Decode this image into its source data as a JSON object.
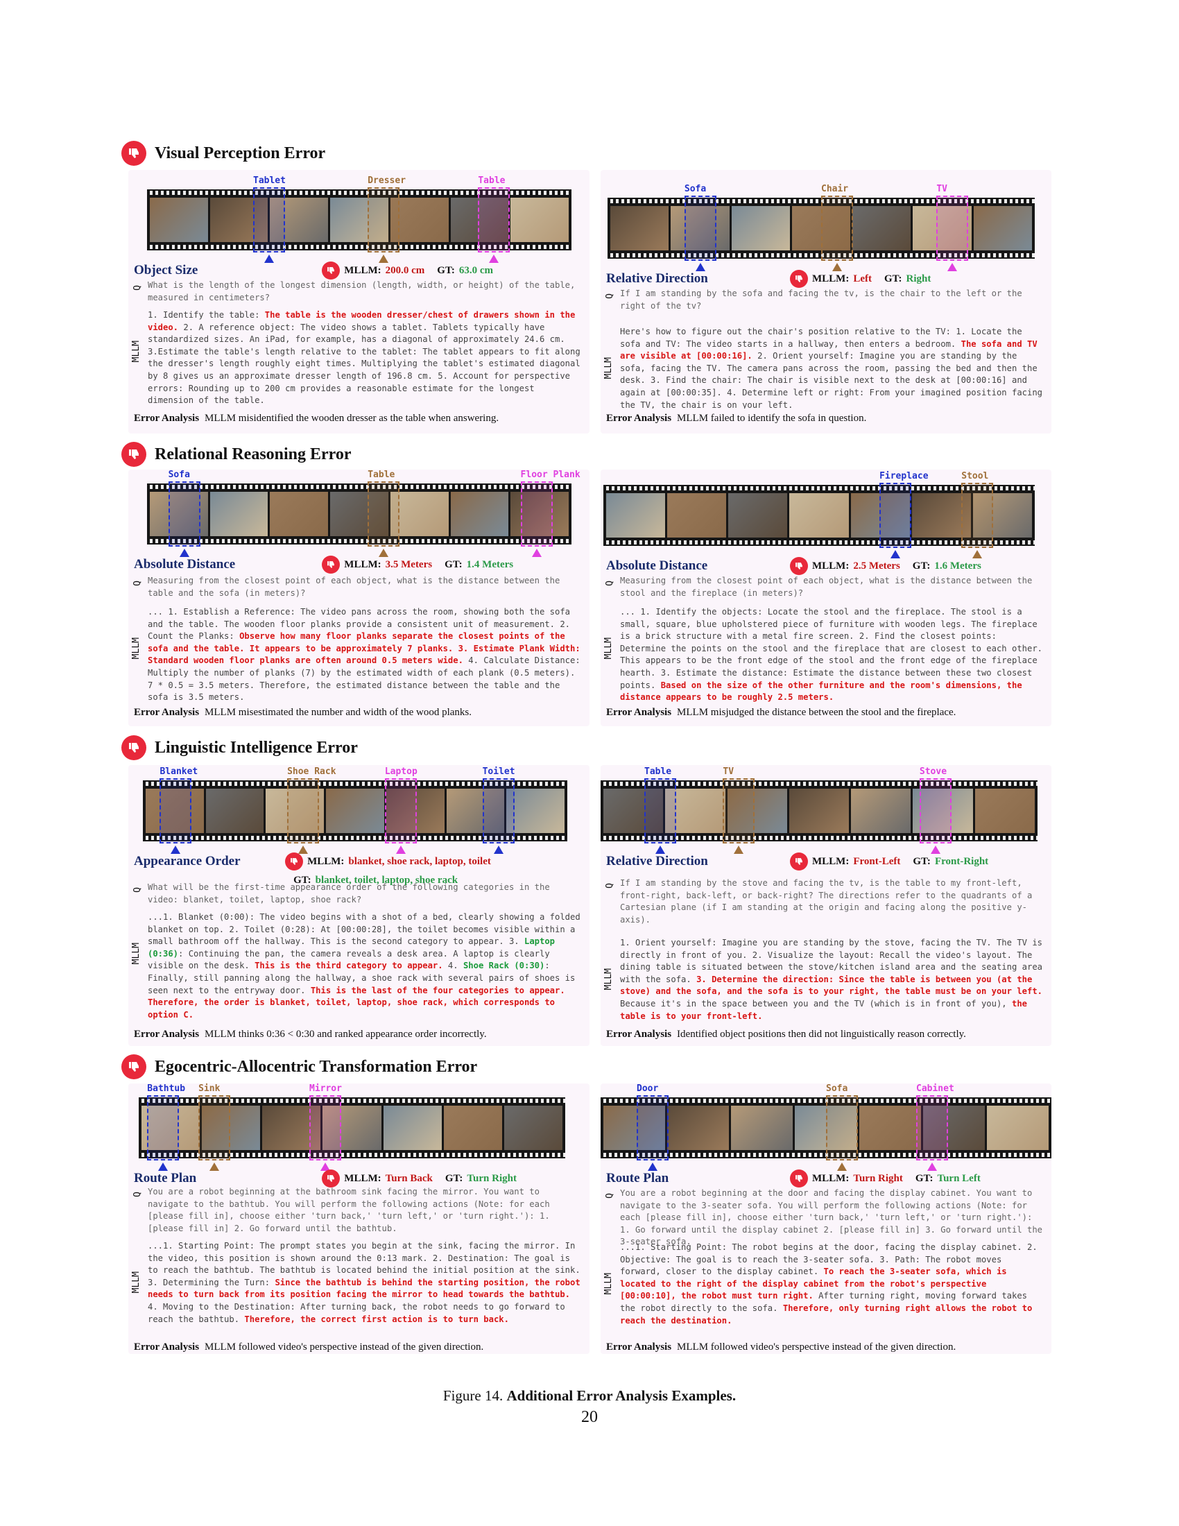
{
  "sections": [
    {
      "title": "Visual Perception Error"
    },
    {
      "title": "Relational Reasoning Error"
    },
    {
      "title": "Linguistic Intelligence Error"
    },
    {
      "title": "Egocentric-Allocentric Transformation Error"
    }
  ],
  "cards": [
    {
      "subtitle": "Object Size",
      "tags": [
        "Tablet",
        "Dresser",
        "Table"
      ],
      "mllm_label": "MLLM:",
      "mllm_value": "200.0 cm",
      "gt_label": "GT:",
      "gt_value": "63.0 cm",
      "q_label": "Q",
      "m_label": "MLLM",
      "question": "What is the length of the longest dimension (length, width, or height) of the table, measured in centimeters?",
      "answer": [
        {
          "t": "1. Identify the table: "
        },
        {
          "t": "The table is the wooden dresser/chest of drawers shown in the video.",
          "c": "red"
        },
        {
          "t": " 2. A reference object: The video shows a tablet. Tablets typically have standardized sizes. An iPad, for example, has a diagonal of approximately 24.6 cm. 3.Estimate the table's length relative to the tablet: The tablet appears to fit along the dresser's length roughly eight times. Multiplying the tablet's estimated diagonal by 8 gives us an approximate dresser length of 196.8 cm. 5. Account for perspective errors: Rounding up to 200 cm provides a reasonable estimate for the longest dimension of the table."
        }
      ],
      "ea_label": "Error Analysis",
      "ea_text": "MLLM misidentified the wooden dresser as the table when answering."
    },
    {
      "subtitle": "Relative Direction",
      "tags": [
        "Sofa",
        "Chair",
        "TV"
      ],
      "mllm_label": "MLLM:",
      "mllm_value": "Left",
      "gt_label": "GT:",
      "gt_value": "Right",
      "q_label": "Q",
      "m_label": "MLLM",
      "question": "If I am standing by the sofa and facing the tv, is the chair to the left or the right of the tv?",
      "answer": [
        {
          "t": "Here's how to figure out the chair's position relative to the TV: 1. Locate the sofa and TV: The video starts in a hallway, then enters a bedroom. "
        },
        {
          "t": "The sofa and TV are visible at [00:00:16].",
          "c": "red"
        },
        {
          "t": " 2. Orient yourself: Imagine you are standing by the sofa, facing the TV.  The camera pans across the room, passing the bed and then the desk. 3. Find the chair: The chair is visible next to the desk at [00:00:16] and again at [00:00:35]. 4. Determine left or right: From your imagined position facing the TV, the chair is on your left."
        }
      ],
      "ea_label": "Error Analysis",
      "ea_text": "MLLM failed to identify the sofa in question."
    },
    {
      "subtitle": "Absolute Distance",
      "tags": [
        "Sofa",
        "Table",
        "Floor Plank"
      ],
      "mllm_label": "MLLM:",
      "mllm_value": "3.5 Meters",
      "gt_label": "GT:",
      "gt_value": "1.4 Meters",
      "q_label": "Q",
      "m_label": "MLLM",
      "question": "Measuring from the closest point of each object, what is the distance between the table and the sofa (in meters)?",
      "answer": [
        {
          "t": "... 1. Establish a Reference: The video pans across the room, showing both the sofa and the table. The wooden floor planks provide a consistent unit of measurement. 2. Count the Planks: "
        },
        {
          "t": "Observe how many floor planks separate the closest points of the sofa and the table. It appears to be approximately 7 planks. 3. Estimate Plank Width: Standard wooden floor planks are often around 0.5 meters wide.",
          "c": "red"
        },
        {
          "t": " 4. Calculate Distance: Multiply the number of planks (7) by the estimated width of each plank (0.5 meters). 7 * 0.5 = 3.5 meters. Therefore, the estimated distance between the table and the sofa is 3.5 meters."
        }
      ],
      "ea_label": "Error Analysis",
      "ea_text": "MLLM misestimated the number and width of the wood planks."
    },
    {
      "subtitle": "Absolute Distance",
      "tags": [
        "Fireplace",
        "Stool"
      ],
      "mllm_label": "MLLM:",
      "mllm_value": "2.5 Meters",
      "gt_label": "GT:",
      "gt_value": "1.6 Meters",
      "q_label": "Q",
      "m_label": "MLLM",
      "question": "Measuring from the closest point of each object, what is the distance between the stool and the fireplace (in meters)?",
      "answer": [
        {
          "t": "... 1. Identify the objects: Locate the stool and the fireplace. The stool is a small, square, blue upholstered piece of furniture with wooden legs. The fireplace is a brick structure with a metal fire screen. 2. Find the closest points: Determine the points on the stool and the fireplace that are closest to each other. This appears to be the front edge of the stool and the front edge of the fireplace hearth. 3. Estimate the distance: Estimate the distance between these two closest points. "
        },
        {
          "t": "Based on the size of the other furniture and the room's dimensions, the distance appears to be roughly 2.5 meters.",
          "c": "red"
        }
      ],
      "ea_label": "Error Analysis",
      "ea_text": "MLLM misjudged the distance between the stool and the fireplace."
    },
    {
      "subtitle": "Appearance Order",
      "tags": [
        "Blanket",
        "Shoe Rack",
        "Laptop",
        "Toilet"
      ],
      "mllm_label": "MLLM:",
      "mllm_value": "blanket, shoe rack, laptop, toilet",
      "gt_label": "GT:",
      "gt_value": "blanket, toilet, laptop, shoe rack",
      "q_label": "Q",
      "m_label": "MLLM",
      "question": "What will be the first-time appearance order of the following categories in the video: blanket, toilet, laptop, shoe rack?",
      "answer": [
        {
          "t": "...1. Blanket (0:00): The video begins with a shot of a bed, clearly showing a folded blanket on top. 2. Toilet (0:28): At [00:00:28], the toilet becomes visible within a small bathroom off the hallway. This is the second category to appear. 3. "
        },
        {
          "t": "Laptop (0:36)",
          "c": "grn"
        },
        {
          "t": ": Continuing the pan, the camera reveals a desk area. A laptop is clearly visible on the desk. "
        },
        {
          "t": "This is the third category to appear.",
          "c": "red"
        },
        {
          "t": " 4. "
        },
        {
          "t": "Shoe Rack (0:30)",
          "c": "grn"
        },
        {
          "t": ": Finally, still panning along the hallway, a shoe rack with several pairs of shoes is seen next to the entryway door. "
        },
        {
          "t": "This is the last of the four categories to appear. Therefore, the order is blanket, toilet, laptop, shoe rack, which corresponds to option C.",
          "c": "red"
        }
      ],
      "ea_label": "Error Analysis",
      "ea_text": "MLLM thinks 0:36 < 0:30 and ranked appearance order incorrectly."
    },
    {
      "subtitle": "Relative Direction",
      "tags": [
        "Table",
        "TV",
        "Stove"
      ],
      "mllm_label": "MLLM:",
      "mllm_value": "Front-Left",
      "gt_label": "GT:",
      "gt_value": "Front-Right",
      "q_label": "Q",
      "m_label": "MLLM",
      "question": "If I am standing by the stove and facing the tv, is the table to my front-left, front-right, back-left, or back-right? The directions refer to the quadrants of a Cartesian plane (if I am standing at the origin and facing along the positive y-axis).",
      "answer": [
        {
          "t": "1. Orient yourself: Imagine you are standing by the stove, facing the TV. The TV is directly in front of you. 2. Visualize the layout: Recall the video's layout. The dining table is situated between the stove/kitchen island area and the seating area with the sofa. "
        },
        {
          "t": "3. Determine the direction: Since the table is between you (at the stove) and the sofa, and the sofa is to your right, the table must be on your left.",
          "c": "red"
        },
        {
          "t": " Because it's in the space between you and the TV (which is in front of you), "
        },
        {
          "t": "the table is to your front-left.",
          "c": "red"
        }
      ],
      "ea_label": "Error Analysis",
      "ea_text": "Identified object positions then did not linguistically reason correctly."
    },
    {
      "subtitle": "Route Plan",
      "tags": [
        "Bathtub",
        "Sink",
        "Mirror"
      ],
      "mllm_label": "MLLM:",
      "mllm_value": "Turn Back",
      "gt_label": "GT:",
      "gt_value": "Turn Right",
      "q_label": "Q",
      "m_label": "MLLM",
      "question": "You are a robot beginning at the bathroom sink facing the mirror. You want to navigate to the bathtub. You will perform the following actions (Note: for each [please fill in], choose either 'turn back,' 'turn left,' or 'turn right.'): 1. [please fill in] 2. Go forward until the bathtub.",
      "answer": [
        {
          "t": "...1. Starting Point: The prompt states you begin at the sink, facing the mirror. In the video, this position is shown around the 0:13 mark. 2. Destination: The goal is to reach the bathtub. The bathtub is located behind the initial position at the sink. 3. Determining the Turn: "
        },
        {
          "t": "Since the bathtub is behind the starting position, the robot needs to turn back from its position facing the mirror to head towards the bathtub.",
          "c": "red"
        },
        {
          "t": " 4. Moving to the Destination: After turning back, the robot needs to go forward to reach the bathtub. "
        },
        {
          "t": "Therefore, the correct first action is to turn back.",
          "c": "red"
        }
      ],
      "ea_label": "Error Analysis",
      "ea_text": "MLLM followed video's perspective instead of the given direction."
    },
    {
      "subtitle": "Route Plan",
      "tags": [
        "Door",
        "Sofa",
        "Cabinet"
      ],
      "mllm_label": "MLLM:",
      "mllm_value": "Turn Right",
      "gt_label": "GT:",
      "gt_value": "Turn Left",
      "q_label": "Q",
      "m_label": "MLLM",
      "question": "You are a robot beginning at the door and facing the display cabinet. You want to navigate to the 3-seater sofa. You will perform the following actions (Note: for each [please fill in], choose either 'turn back,' 'turn left,' or 'turn right.'): 1. Go forward until the display cabinet 2. [please fill in] 3. Go forward until the 3-seater sofa.",
      "answer": [
        {
          "t": "...1. Starting Point: The robot begins at the door, facing the display cabinet. 2. Objective: The goal is to reach the 3-seater sofa. 3. Path: The robot moves forward, closer to the display cabinet. "
        },
        {
          "t": "To reach the 3-seater sofa, which is located to the right of the display cabinet from the robot's perspective [00:00:10], the robot must turn right.",
          "c": "red"
        },
        {
          "t": " After turning right, moving forward takes the robot directly to the sofa. "
        },
        {
          "t": "Therefore, only turning right allows the robot to reach the destination.",
          "c": "red"
        }
      ],
      "ea_label": "Error Analysis",
      "ea_text": "MLLM followed video's perspective instead of the given direction."
    }
  ],
  "colors": {
    "tag_colors": [
      "#2233cc",
      "#a0703a",
      "#e040e0"
    ],
    "red": "#d81616",
    "green": "#2b9a48",
    "heading": "#1a2b6b",
    "frame_tones": [
      "#8a6a4a",
      "#5a4a3a",
      "#b59a78",
      "#7a8a96",
      "#9a7a5a",
      "#6a6a6a",
      "#c8b89a"
    ]
  },
  "caption": {
    "prefix": "Figure 14.",
    "bold": "Additional Error Analysis Examples."
  },
  "page_number": "20"
}
